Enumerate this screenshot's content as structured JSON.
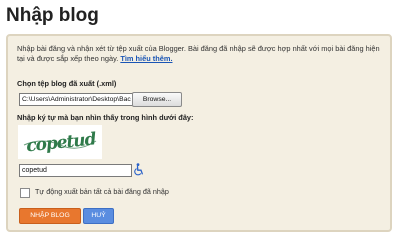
{
  "page": {
    "title": "Nhập blog"
  },
  "intro": {
    "text": "Nhập bài đăng và nhận xét từ tệp xuất của Blogger. Bài đăng đã nhập sẽ được hợp nhất với mọi bài đăng hiện tại và được sắp xếp theo ngày.",
    "link": "Tìm hiểu thêm."
  },
  "file": {
    "label": "Chọn tệp blog đã xuất (.xml)",
    "path": "C:\\Users\\Administrator\\Desktop\\Bac",
    "browse_label": "Browse..."
  },
  "captcha": {
    "label": "Nhập ký tự mà bạn nhìn thấy trong hình dưới đây:",
    "image_text": "copetud",
    "value": "copetud"
  },
  "auto_publish": {
    "label": "Tự động xuất bản tất cả bài đăng đã nhập",
    "checked": false
  },
  "buttons": {
    "import": "NHẬP BLOG",
    "cancel": "HUỶ"
  },
  "colors": {
    "panel_background": "#f4efe2",
    "panel_border": "#ddd4bf",
    "import_button": "#e8772e",
    "cancel_button": "#5a8de0",
    "link": "#1a55b5",
    "captcha_ink": "#2f7a4a"
  },
  "icons": {
    "accessibility": "wheelchair-icon"
  }
}
